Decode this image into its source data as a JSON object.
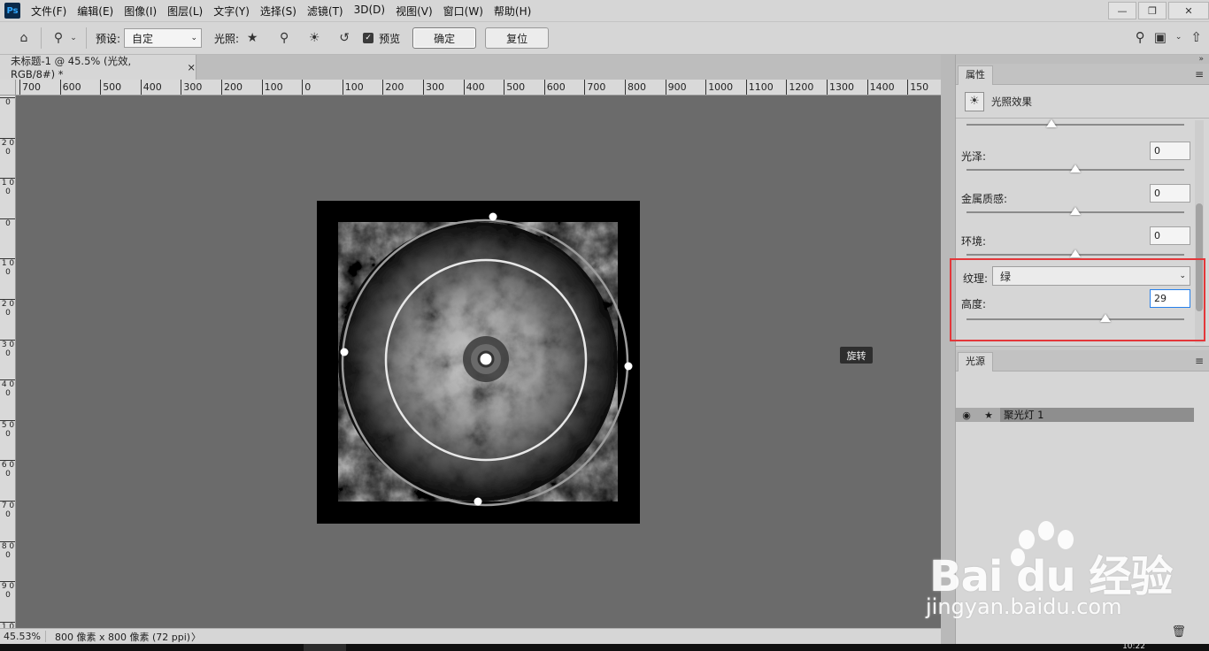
{
  "app": {
    "logo": "Ps"
  },
  "menu": [
    "文件(F)",
    "编辑(E)",
    "图像(I)",
    "图层(L)",
    "文字(Y)",
    "选择(S)",
    "滤镜(T)",
    "3D(D)",
    "视图(V)",
    "窗口(W)",
    "帮助(H)"
  ],
  "options": {
    "preset_label": "预设:",
    "preset_value": "自定",
    "light_label": "光照:",
    "preview_label": "预览",
    "ok_label": "确定",
    "reset_label": "复位"
  },
  "document": {
    "tab_title": "未标题-1 @ 45.5% (光效, RGB/8#) *",
    "tab_close": "×",
    "ruler_h": [
      "700",
      "600",
      "500",
      "400",
      "300",
      "200",
      "100",
      "0",
      "100",
      "200",
      "300",
      "400",
      "500",
      "600",
      "700",
      "800",
      "900",
      "1000",
      "1100",
      "1200",
      "1300",
      "1400",
      "150"
    ],
    "ruler_v": [
      "0",
      "2 0 0",
      "1 0 0",
      "0",
      "1 0 0",
      "2 0 0",
      "3 0 0",
      "4 0 0",
      "5 0 0",
      "6 0 0",
      "7 0 0",
      "8 0 0",
      "9 0 0",
      "1 0 0"
    ],
    "tooltip": "旋转"
  },
  "status": {
    "zoom": "45.53%",
    "info": "800 像素 x 800 像素 (72 ppi)",
    "arrow": "〉"
  },
  "properties": {
    "tab": "属性",
    "menu_icon": "≡",
    "title": "光照效果",
    "collapse_glyph": "»",
    "rows": [
      {
        "label": "光泽:",
        "value": "0",
        "level": 0.5
      },
      {
        "label": "金属质感:",
        "value": "0",
        "level": 0.5
      },
      {
        "label": "环境:",
        "value": "0",
        "level": 0.5
      }
    ],
    "top_slider_level": 0.39,
    "texture_label": "纹理:",
    "texture_value": "绿",
    "height_label": "高度:",
    "height_value": "29",
    "height_level": 0.64
  },
  "lights": {
    "tab": "光源",
    "menu_icon": "≡",
    "items": [
      {
        "name": "聚光灯 1"
      }
    ]
  },
  "watermark": {
    "brand": "Bai du 经验",
    "url": "jingyan.baidu.com"
  },
  "taskbar": {
    "clock": "10:22"
  }
}
